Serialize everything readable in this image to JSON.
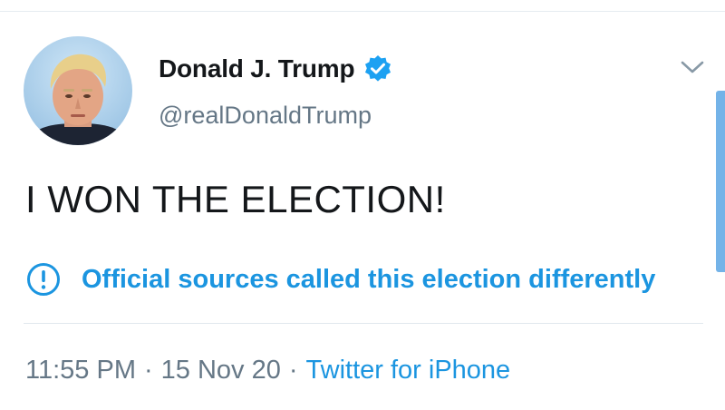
{
  "tweet": {
    "author": {
      "display_name": "Donald J. Trump",
      "handle": "@realDonaldTrump",
      "verified": true,
      "avatar_icon": "profile-photo",
      "verified_icon": "verified-badge-icon",
      "verified_color": "#1da1f2"
    },
    "text": "I WON THE ELECTION!",
    "notice": {
      "icon": "exclamation-circle-icon",
      "text": "Official sources called this election differently",
      "color": "#1b95e0"
    },
    "meta": {
      "time": "11:55 PM",
      "separator": "·",
      "date": "15 Nov 20",
      "source": "Twitter for iPhone"
    },
    "menu_icon": "chevron-down-icon"
  }
}
